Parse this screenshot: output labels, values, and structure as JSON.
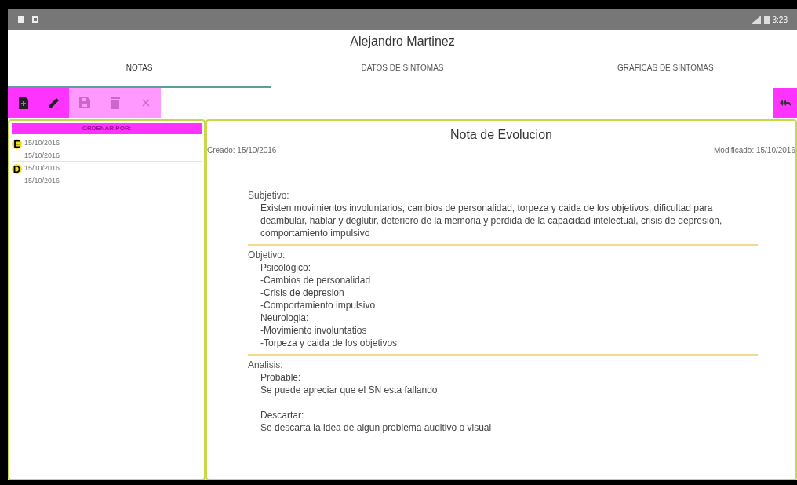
{
  "status_bar": {
    "time": "3:23"
  },
  "patient_name": "Alejandro Martinez",
  "tabs": [
    {
      "label": "NOTAS",
      "selected": true
    },
    {
      "label": "DATOS DE SINTOMAS",
      "selected": false
    },
    {
      "label": "GRAFICAS DE SINTOMAS",
      "selected": false
    }
  ],
  "toolbar": [
    {
      "kind": "new",
      "disabled": false
    },
    {
      "kind": "edit",
      "disabled": false
    },
    {
      "kind": "save",
      "disabled": true
    },
    {
      "kind": "delete",
      "disabled": true
    },
    {
      "kind": "close",
      "disabled": true
    }
  ],
  "sort_header": "ORDENAR POR:",
  "notes": [
    {
      "letter": "E",
      "dates": [
        "15/10/2016",
        "15/10/2016"
      ]
    },
    {
      "letter": "D",
      "dates": [
        "15/10/2016",
        "15/10/2016"
      ]
    }
  ],
  "note": {
    "title": "Nota de Evolucion",
    "created": "Creado: 15/10/2016",
    "modified": "Modificado: 15/10/2016",
    "sections": [
      {
        "label": "Subjetivo:",
        "blocks": [
          [
            "Existen movimientos involuntarios, cambios de personalidad, torpeza y caida de los objetivos, dificultad para deambular, hablar y deglutir, deterioro de la memoria y perdida de la capacidad intelectual, crisis de depresión, comportamiento impulsivo"
          ]
        ]
      },
      {
        "label": "Objetivo:",
        "blocks": [
          [
            "Psicológico:",
            "-Cambios de personalidad",
            "-Crisis de depresion",
            "-Comportamiento impulsivo",
            "Neurologia:",
            "-Movimiento involuntatios",
            "-Torpeza y caida de los objetivos"
          ]
        ]
      },
      {
        "label": "Analisis:",
        "blocks": [
          [
            "Probable:",
            "Se puede apreciar que el SN esta fallando"
          ],
          [
            "Descartar:",
            "Se descarta la idea de algun problema auditivo o visual"
          ]
        ]
      }
    ]
  }
}
